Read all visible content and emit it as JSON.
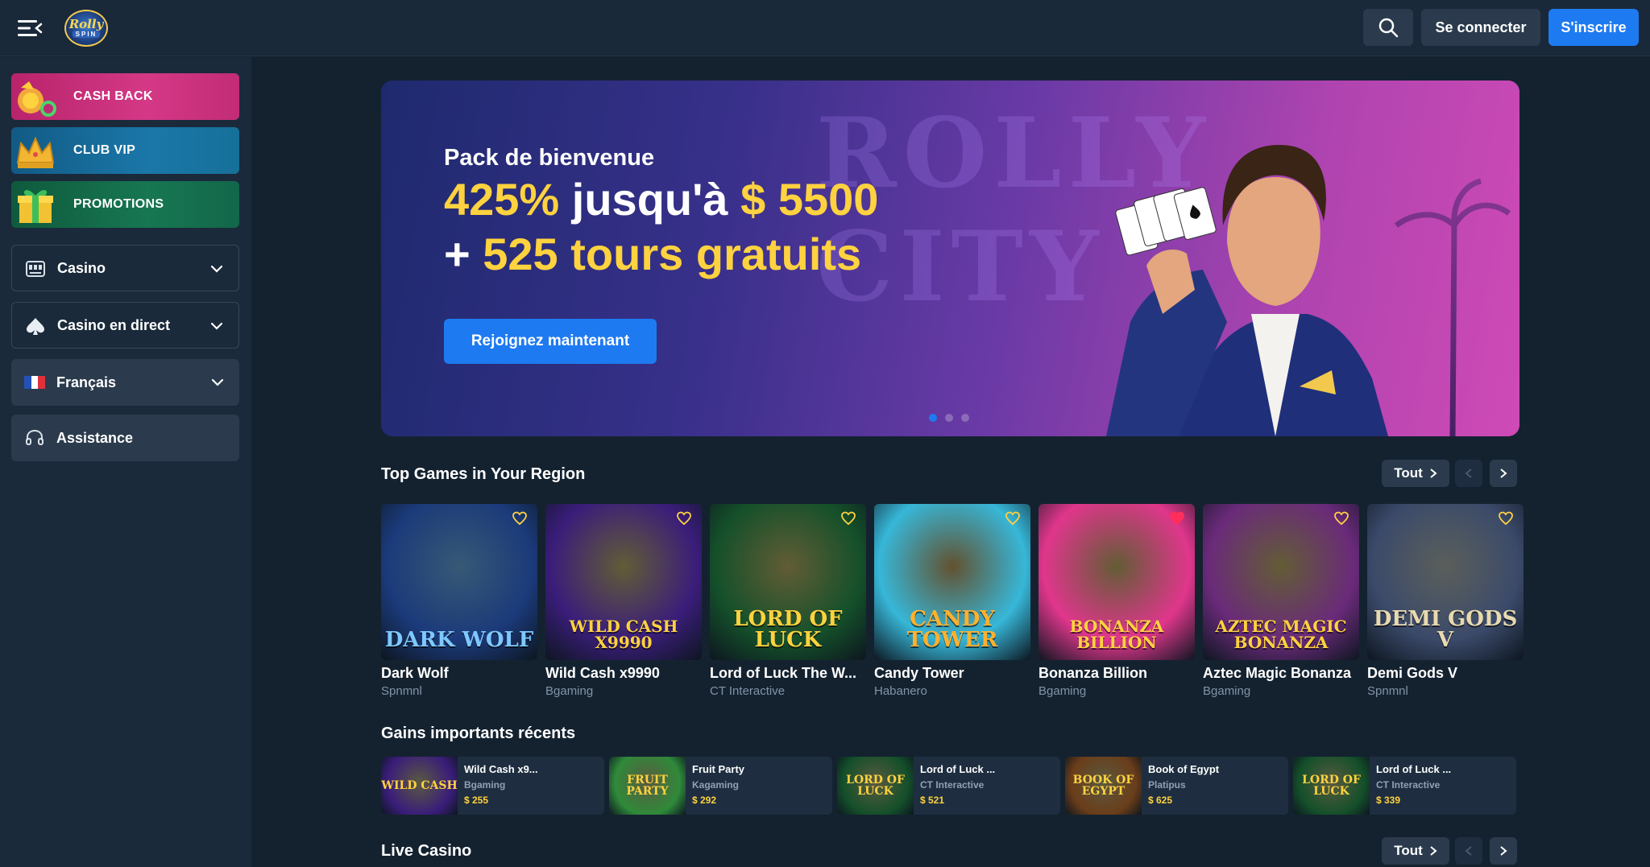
{
  "header": {
    "logo_top": "Rolly",
    "logo_bottom": "SPIN",
    "login_label": "Se connecter",
    "signup_label": "S'inscrire",
    "icons": [
      "menu-icon",
      "search-icon"
    ]
  },
  "sidebar": {
    "promos": [
      {
        "label": "CASH BACK",
        "icon": "cashback-icon"
      },
      {
        "label": "CLUB VIP",
        "icon": "crown-icon"
      },
      {
        "label": "PROMOTIONS",
        "icon": "gift-icon"
      }
    ],
    "nav": [
      {
        "label": "Casino",
        "icon": "slot-machine-icon"
      },
      {
        "label": "Casino en direct",
        "icon": "spade-icon"
      },
      {
        "label": "Français",
        "icon": "france-flag-icon"
      },
      {
        "label": "Assistance",
        "icon": "headset-icon"
      }
    ]
  },
  "hero": {
    "background_text": "ROLLY CITY",
    "kicker": "Pack de bienvenue",
    "line1_pct": "425%",
    "line1_mid": " jusqu'à ",
    "line1_amount": "$ 5500",
    "line2_plus": "+ ",
    "line2_rest": "525 tours gratuits",
    "cta": "Rejoignez maintenant",
    "slides": 3,
    "active_slide": 1
  },
  "top_games": {
    "title": "Top Games in Your Region",
    "all_label": "Tout",
    "items": [
      {
        "name": "Dark Wolf",
        "provider": "Spnmnl",
        "art": "DARK WOLF",
        "bg": "#1b3a7a",
        "accent": "#7ec8ff",
        "fav": false
      },
      {
        "name": "Wild Cash x9990",
        "provider": "Bgaming",
        "art": "WILD CASH X9990",
        "bg": "#3a1d7a",
        "accent": "#ffd23f",
        "fav": false
      },
      {
        "name": "Lord of Luck The W...",
        "provider": "CT Interactive",
        "art": "LORD OF LUCK",
        "bg": "#14502a",
        "accent": "#ffd23f",
        "fav": false
      },
      {
        "name": "Candy Tower",
        "provider": "Habanero",
        "art": "CANDY TOWER",
        "bg": "#37b7d8",
        "accent": "#ffb02e",
        "fav": false
      },
      {
        "name": "Bonanza Billion",
        "provider": "Bgaming",
        "art": "BONANZA BILLION",
        "bg": "#e0368c",
        "accent": "#ffd23f",
        "fav": true
      },
      {
        "name": "Aztec Magic Bonanza",
        "provider": "Bgaming",
        "art": "AZTEC MAGIC BONANZA",
        "bg": "#6a2a7a",
        "accent": "#ffd23f",
        "fav": false
      },
      {
        "name": "Demi Gods V",
        "provider": "Spnmnl",
        "art": "DEMI GODS V",
        "bg": "#3b4a6a",
        "accent": "#e8d9b0",
        "fav": false
      }
    ]
  },
  "recent_wins": {
    "title": "Gains importants récents",
    "items": [
      {
        "name": "Wild Cash x9...",
        "provider": "Bgaming",
        "amount": "$ 255",
        "art": "WILD CASH",
        "bg": "#3a1d7a",
        "accent": "#ffd23f"
      },
      {
        "name": "Fruit Party",
        "provider": "Kagaming",
        "amount": "$ 292",
        "art": "FRUIT PARTY",
        "bg": "#2f8a3a",
        "accent": "#ffd23f"
      },
      {
        "name": "Lord of Luck ...",
        "provider": "CT Interactive",
        "amount": "$ 521",
        "art": "LORD OF LUCK",
        "bg": "#14502a",
        "accent": "#ffd23f"
      },
      {
        "name": "Book of Egypt",
        "provider": "Platipus",
        "amount": "$ 625",
        "art": "BOOK OF EGYPT",
        "bg": "#6a3d1a",
        "accent": "#ffd23f"
      },
      {
        "name": "Lord of Luck ...",
        "provider": "CT Interactive",
        "amount": "$ 339",
        "art": "LORD OF LUCK",
        "bg": "#14502a",
        "accent": "#ffd23f"
      }
    ]
  },
  "live_casino": {
    "title": "Live Casino",
    "all_label": "Tout"
  },
  "colors": {
    "bg": "#142230",
    "panel": "#1a2a3b",
    "button": "#2b3b4d",
    "primary": "#1e7af0",
    "yellow": "#ffd23f"
  }
}
